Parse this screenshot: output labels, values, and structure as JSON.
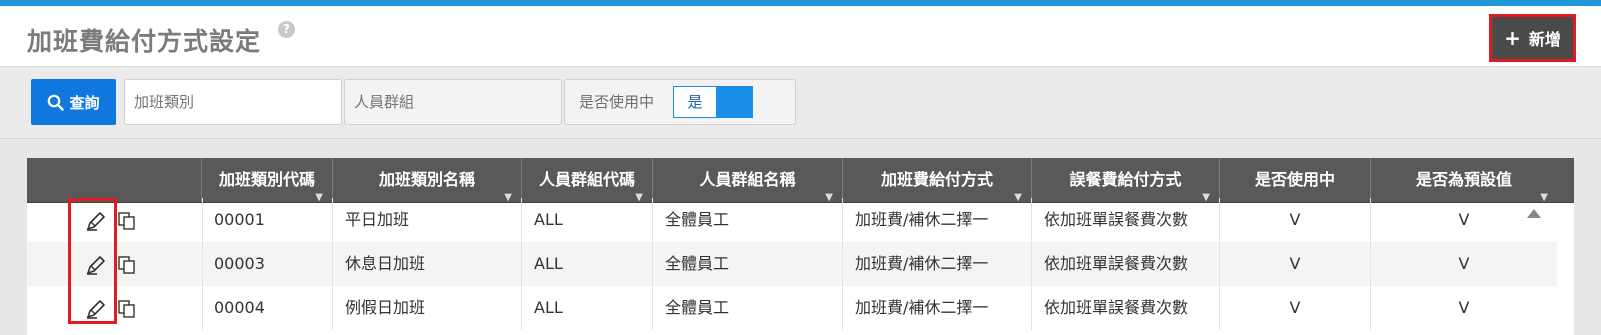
{
  "header": {
    "title": "加班費給付方式設定",
    "help_icon": "?",
    "add_button": {
      "icon": "plus-icon",
      "plus": "+",
      "label": "新增"
    }
  },
  "filters": {
    "query_button": {
      "icon": "search-icon",
      "label": "查詢"
    },
    "overtime_type": {
      "placeholder": "加班類別",
      "value": ""
    },
    "personnel_group": {
      "placeholder": "人員群組",
      "value": ""
    },
    "in_use": {
      "label": "是否使用中",
      "toggle_value": "是"
    }
  },
  "table": {
    "columns": [
      "加班類別代碼",
      "加班類別名稱",
      "人員群組代碼",
      "人員群組名稱",
      "加班費給付方式",
      "誤餐費給付方式",
      "是否使用中",
      "是否為預設值"
    ],
    "filter_icon": "▼",
    "rows": [
      {
        "code": "00001",
        "name": "平日加班",
        "group_code": "ALL",
        "group_name": "全體員工",
        "pay_method": "加班費/補休二擇一",
        "meal_method": "依加班單誤餐費次數",
        "in_use": "V",
        "is_default": "V"
      },
      {
        "code": "00003",
        "name": "休息日加班",
        "group_code": "ALL",
        "group_name": "全體員工",
        "pay_method": "加班費/補休二擇一",
        "meal_method": "依加班單誤餐費次數",
        "in_use": "V",
        "is_default": "V"
      },
      {
        "code": "00004",
        "name": "例假日加班",
        "group_code": "ALL",
        "group_name": "全體員工",
        "pay_method": "加班費/補休二擇一",
        "meal_method": "依加班單誤餐費次數",
        "in_use": "V",
        "is_default": "V"
      }
    ]
  },
  "colors": {
    "top_bar": "#1f97d9",
    "primary_button": "#1177e0",
    "dark_button": "#4a4a4a",
    "highlight": "#e01b22",
    "table_header": "#595959",
    "toggle": "#1a8fe8"
  }
}
